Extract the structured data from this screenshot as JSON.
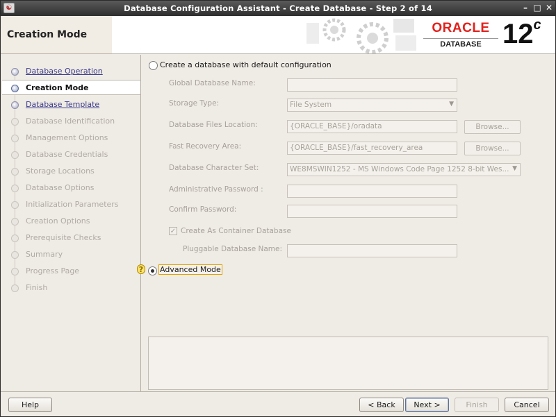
{
  "window": {
    "title": "Database Configuration Assistant - Create Database - Step 2 of 14",
    "app_icon": "dbca-app-icon",
    "minimize": "–",
    "maximize": "□",
    "close": "✕"
  },
  "header": {
    "step_title": "Creation Mode",
    "brand": "ORACLE",
    "product": "DATABASE",
    "version": "12",
    "version_suffix": "c"
  },
  "nav": {
    "items": [
      {
        "label": "Database Operation",
        "state": "done"
      },
      {
        "label": "Creation Mode",
        "state": "current"
      },
      {
        "label": "Database Template",
        "state": "done"
      },
      {
        "label": "Database Identification",
        "state": "pending"
      },
      {
        "label": "Management Options",
        "state": "pending"
      },
      {
        "label": "Database Credentials",
        "state": "pending"
      },
      {
        "label": "Storage Locations",
        "state": "pending"
      },
      {
        "label": "Database Options",
        "state": "pending"
      },
      {
        "label": "Initialization Parameters",
        "state": "pending"
      },
      {
        "label": "Creation Options",
        "state": "pending"
      },
      {
        "label": "Prerequisite Checks",
        "state": "pending"
      },
      {
        "label": "Summary",
        "state": "pending"
      },
      {
        "label": "Progress Page",
        "state": "pending"
      },
      {
        "label": "Finish",
        "state": "pending"
      }
    ]
  },
  "form": {
    "default_config_label": "Create a database with default configuration",
    "default_config_selected": false,
    "global_db_name_label": "Global Database Name:",
    "global_db_name_value": "",
    "storage_type_label": "Storage Type:",
    "storage_type_value": "File System",
    "db_files_location_label": "Database Files Location:",
    "db_files_location_value": "{ORACLE_BASE}/oradata",
    "fast_recovery_label": "Fast Recovery Area:",
    "fast_recovery_value": "{ORACLE_BASE}/fast_recovery_area",
    "charset_label": "Database Character Set:",
    "charset_value": "WE8MSWIN1252 - MS Windows Code Page 1252 8-bit Wes...",
    "admin_password_label": "Administrative Password :",
    "admin_password_value": "",
    "confirm_password_label": "Confirm Password:",
    "confirm_password_value": "",
    "container_db_label": "Create As Container Database",
    "container_db_checked": true,
    "pluggable_db_label": "Pluggable Database Name:",
    "pluggable_db_value": "",
    "browse_label": "Browse...",
    "advanced_mode_label": "Advanced Mode",
    "advanced_mode_selected": true
  },
  "footer": {
    "help": "Help",
    "back": "< Back",
    "next": "Next >",
    "finish": "Finish",
    "cancel": "Cancel"
  },
  "colors": {
    "oracle_red": "#e2211c",
    "titlebar": "#3a3a3a",
    "nav_done_link": "#3b3b8c"
  }
}
